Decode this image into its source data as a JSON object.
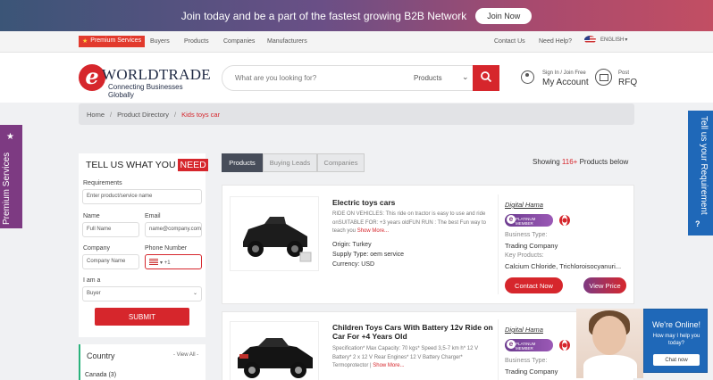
{
  "promo": {
    "text": "Join today and be a part of the fastest growing B2B Network",
    "join_label": "Join Now"
  },
  "nav": {
    "premium": "Premium Services",
    "links": [
      "Buyers",
      "Products",
      "Companies",
      "Manufacturers"
    ],
    "right_links": [
      "Contact Us",
      "Need Help?"
    ],
    "language": "ENGLISH"
  },
  "header": {
    "logo_name": "WORLDTRADE",
    "logo_tagline": "Connecting Businesses Globally",
    "search_placeholder": "What are you looking for?",
    "search_category": "Products",
    "account_small": "Sign In / Join Free",
    "account_big": "My Account",
    "post_small": "Post",
    "post_big": "RFQ"
  },
  "breadcrumb": [
    "Home",
    "Product Directory",
    "Kids toys car"
  ],
  "side_tabs": {
    "left": "Premium Services",
    "right": "Tell us your Requirement"
  },
  "tell_us": {
    "title_prefix": "TELL US WHAT YOU",
    "title_highlight": "NEED",
    "requirements_label": "Requirements",
    "requirements_placeholder": "Enter product/service name",
    "name_label": "Name",
    "name_placeholder": "Full Name",
    "email_label": "Email",
    "email_placeholder": "name@company.com",
    "company_label": "Company",
    "company_placeholder": "Company Name",
    "phone_label": "Phone Number",
    "phone_code": "+1",
    "iam_label": "I am a",
    "iam_value": "Buyer",
    "submit_label": "SUBMIT"
  },
  "country": {
    "title": "Country",
    "view_all": "- View All -",
    "first_item": "Canada (3)"
  },
  "tabs": [
    "Products",
    "Buying Leads",
    "Companies"
  ],
  "results": {
    "prefix": "Showing",
    "count": "116+",
    "suffix": "Products below"
  },
  "products": [
    {
      "title": "Electric toys cars",
      "desc": "RIDE ON VEHICLES: This ride on tractor is easy to use and ride onSUITABLE FOR: +3 years oldFUN RUN : The best Fun way to teach you",
      "more": "Show More...",
      "origin": "Origin: Turkey",
      "supply": "Supply Type: oem service",
      "currency": "Currency: USD",
      "seller": "Digital Hama",
      "badge": "PLATINUM MEMBER",
      "business_type_label": "Business Type:",
      "business_type": "Trading Company",
      "key_products_label": "Key Products:",
      "key_products": "Calcium Chloride, Trichloroisocyanuri...",
      "contact_label": "Contact Now",
      "price_label": "View Price"
    },
    {
      "title": "Children Toys Cars With Battery 12v Ride on Car For +4 Years Old",
      "desc": "Specification* Max Capacity: 70 kgs* Speed 3,5-7 km h* 12 V Battery* 2 x 12 V Rear Engines* 12 V Battery Charger* Termoprotector |",
      "more": "Show More...",
      "seller": "Digital Hama",
      "badge": "PLATINUM MEMBER",
      "business_type_label": "Business Type:",
      "business_type": "Trading Company"
    }
  ],
  "chat": {
    "title": "We're Online!",
    "subtitle": "How may I help you today?",
    "button": "Chat now"
  },
  "colors": {
    "accent": "#d6262c",
    "purple": "#7d3a82",
    "blue": "#1f68b8"
  }
}
